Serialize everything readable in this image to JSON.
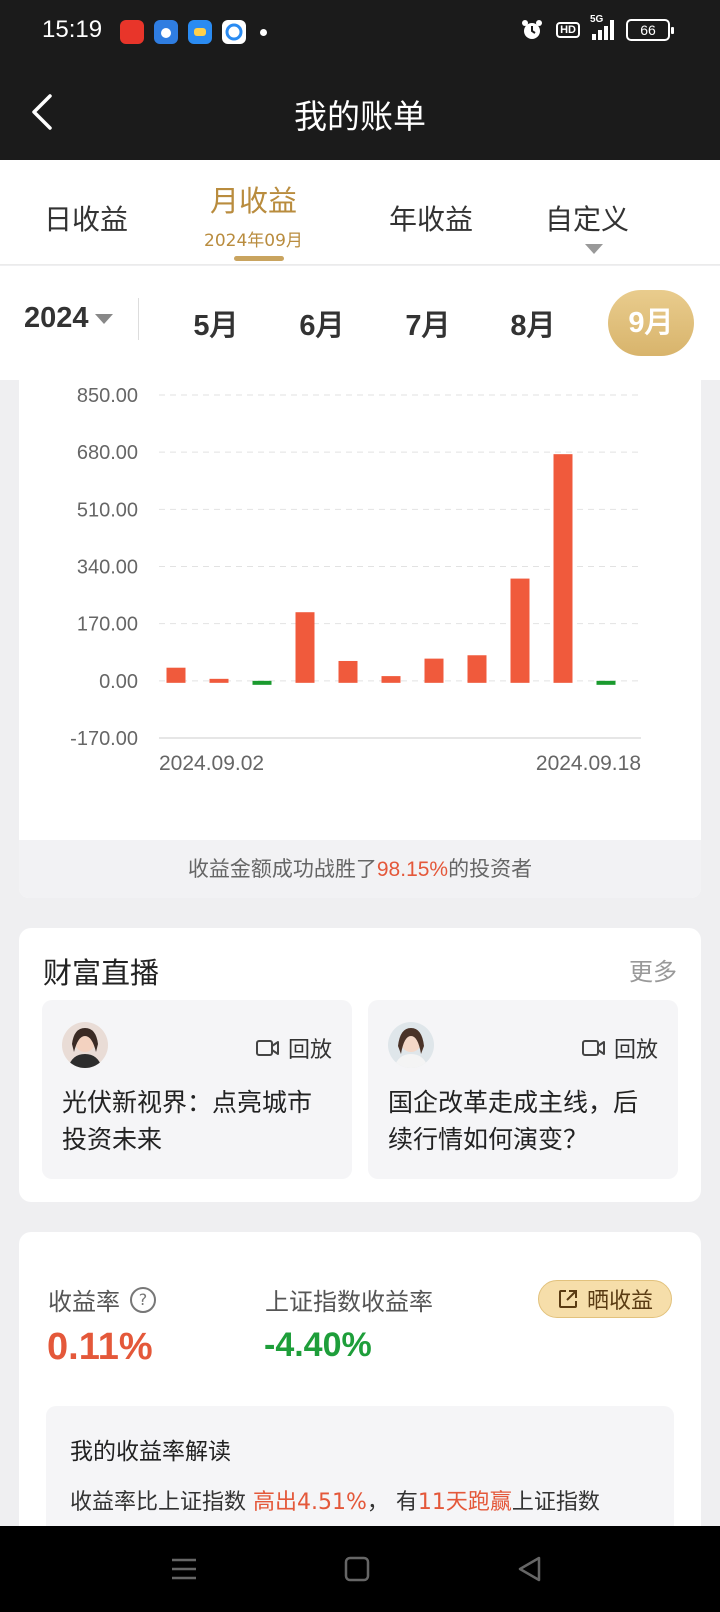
{
  "status_bar": {
    "time": "15:19",
    "hd": "HD",
    "network": "5G",
    "battery": "66",
    "icons": [
      "app-red-icon",
      "baidu-icon",
      "app-blue-icon",
      "browser-icon",
      "alarm-icon"
    ]
  },
  "header": {
    "title": "我的账单"
  },
  "period_tabs": {
    "daily": "日收益",
    "monthly": "月收益",
    "monthly_sub": "2024年09月",
    "yearly": "年收益",
    "custom": "自定义"
  },
  "month_selector": {
    "year": "2024",
    "months": [
      "5月",
      "6月",
      "7月",
      "8月",
      "9月"
    ],
    "selected": "9月"
  },
  "chart_data": {
    "type": "bar",
    "categories": [
      "2024.09.02",
      "",
      "",
      "",
      "",
      "",
      "",
      "",
      "",
      "",
      "2024.09.18"
    ],
    "values": [
      45,
      10,
      -8,
      210,
      65,
      20,
      72,
      82,
      310,
      680,
      -8
    ],
    "ylim": [
      -170,
      850
    ],
    "y_ticks": [
      "850.00",
      "680.00",
      "510.00",
      "340.00",
      "170.00",
      "0.00",
      "-170.00"
    ],
    "x_tick_labels": [
      "2024.09.02",
      "2024.09.18"
    ],
    "grid": true,
    "colors": {
      "positive": "#f05a3c",
      "negative": "#1a9a2e"
    }
  },
  "beat": {
    "prefix": "收益金额成功战胜了",
    "percent": "98.15%",
    "suffix": "的投资者"
  },
  "live": {
    "title": "财富直播",
    "more": "更多",
    "items": [
      {
        "replay": "回放",
        "title": "光伏新视界：点亮城市投资未来"
      },
      {
        "replay": "回放",
        "title": "国企改革走成主线，后续行情如何演变？"
      }
    ]
  },
  "returns": {
    "label": "收益率",
    "value": "0.11%",
    "index_label": "上证指数收益率",
    "index_value": "-4.40%",
    "share": "晒收益",
    "interp_title": "我的收益率解读",
    "interp_pre": "收益率比上证指数 ",
    "interp_high": "高出4.51%",
    "interp_mid": "， 有",
    "interp_days": "11天跑赢",
    "interp_post": "上证指数"
  },
  "colors": {
    "accent_gold": "#b98c3e",
    "up_red": "#e4583a",
    "down_green": "#1e9e3a"
  }
}
